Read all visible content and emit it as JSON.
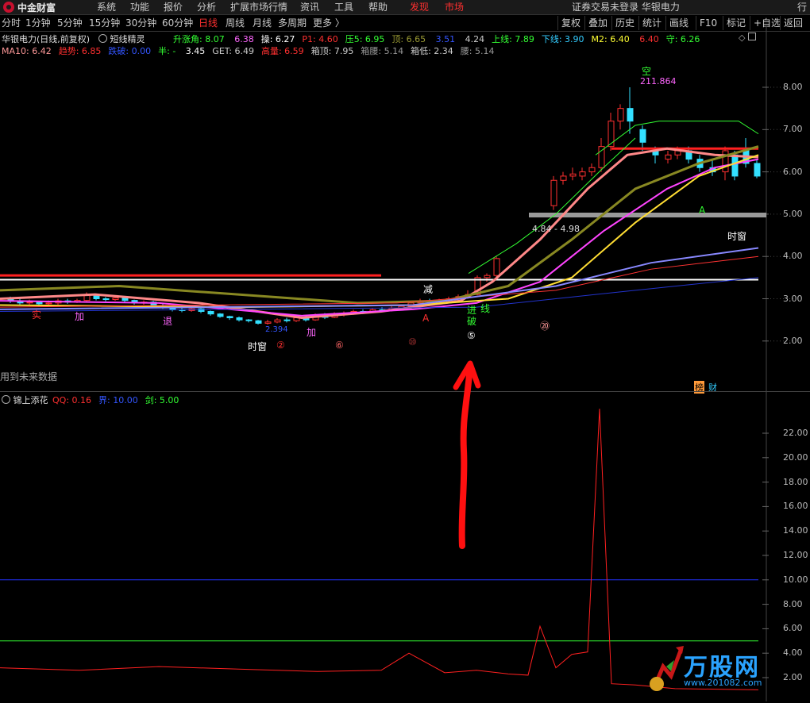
{
  "menubar": {
    "logo_text": "中金财富",
    "items": [
      "系统",
      "功能",
      "报价",
      "分析",
      "扩展市场行情",
      "资讯",
      "工具",
      "帮助"
    ],
    "highlight_items": [
      "发现",
      "市场"
    ],
    "status": "证券交易未登录  华银电力",
    "win_buttons": [
      "行"
    ]
  },
  "toolbar": {
    "periods": [
      "分时",
      "1分钟",
      "5分钟",
      "15分钟",
      "30分钟",
      "60分钟",
      "日线",
      "周线",
      "月线",
      "多周期",
      "更多 〉"
    ],
    "active_period": "日线",
    "right_buttons": [
      "复权",
      "叠加",
      "历史",
      "统计",
      "画线",
      "F10",
      "标记",
      "+自选",
      "返回"
    ]
  },
  "main_panel": {
    "title": "华银电力(日线,前复权)",
    "indicator_name": "短线精灵",
    "line1": [
      {
        "label": "升涨角:",
        "value": "8.07",
        "color": "#33ff33"
      },
      {
        "label": "",
        "value": "6.38",
        "color": "#ff66ff"
      },
      {
        "label": "操:",
        "value": "6.27",
        "color": "#ffffff"
      },
      {
        "label": "P1:",
        "value": "4.60",
        "color": "#ff3030"
      },
      {
        "label": "压5:",
        "value": "6.95",
        "color": "#33ff33"
      },
      {
        "label": "顶:",
        "value": "6.65",
        "color": "#999933"
      },
      {
        "label": "",
        "value": "3.51",
        "color": "#3355ff"
      },
      {
        "label": "",
        "value": "4.24",
        "color": "#cccccc"
      },
      {
        "label": "上线:",
        "value": "7.89",
        "color": "#33ff33"
      },
      {
        "label": "下线:",
        "value": "3.90",
        "color": "#33ccff"
      },
      {
        "label": "M2:",
        "value": "6.40",
        "color": "#ffff33"
      },
      {
        "label": "",
        "value": "6.40",
        "color": "#ff3030"
      },
      {
        "label": "守:",
        "value": "6.26",
        "color": "#33ff33"
      }
    ],
    "line2": [
      {
        "label": "MA10:",
        "value": "6.42",
        "color": "#ff9999"
      },
      {
        "label": "趋势:",
        "value": "6.85",
        "color": "#ff3030"
      },
      {
        "label": "跌破:",
        "value": "0.00",
        "color": "#3355ff"
      },
      {
        "label": "半:",
        "value": "-",
        "color": "#33ff33"
      },
      {
        "label": "",
        "value": "3.45",
        "color": "#ffffff"
      },
      {
        "label": "GET:",
        "value": "6.49",
        "color": "#cccccc"
      },
      {
        "label": "高量:",
        "value": "6.59",
        "color": "#ff3030"
      },
      {
        "label": "箱顶:",
        "value": "7.95",
        "color": "#cccccc"
      },
      {
        "label": "箱腰:",
        "value": "5.14",
        "color": "#999999"
      },
      {
        "label": "箱低:",
        "value": "2.34",
        "color": "#cccccc"
      },
      {
        "label": "腰:",
        "value": "5.14",
        "color": "#999999"
      }
    ],
    "future_note": "用到未来数据",
    "y_ticks": [
      "8.00",
      "7.00",
      "6.00",
      "5.00",
      "4.00",
      "3.00",
      "2.00"
    ],
    "annotations": {
      "kong": "空",
      "peak_price": "211.864",
      "range_label": "4.84 - 4.98",
      "shichuang_left": "时窗",
      "shichuang_right": "时窗",
      "shi": "实",
      "jia1": "加",
      "jia2": "加",
      "jian": "减",
      "jin": "进",
      "po": "破",
      "xian": "线",
      "tui": "退",
      "circle2": "②",
      "circle6": "⑥",
      "circle5": "⑤",
      "n10": "⑩",
      "n20": "⑳",
      "A1": "A",
      "A2": "A",
      "bang": "榜",
      "cai": "财",
      "low_label": "2.394"
    }
  },
  "sub_panel": {
    "name": "锦上添花",
    "values": [
      {
        "label": "QQ:",
        "value": "0.16",
        "color": "#ff3030"
      },
      {
        "label": "界:",
        "value": "10.00",
        "color": "#3355ff"
      },
      {
        "label": "剑:",
        "value": "5.00",
        "color": "#33ff33"
      }
    ],
    "y_ticks": [
      "22.00",
      "20.00",
      "18.00",
      "16.00",
      "14.00",
      "12.00",
      "10.00",
      "8.00",
      "6.00",
      "4.00",
      "2.00"
    ]
  },
  "watermark": {
    "text": "万股网",
    "url": "www.201082.com"
  },
  "colors": {
    "up": "#ff3030",
    "down": "#33e0ff",
    "bg": "#000000"
  }
}
